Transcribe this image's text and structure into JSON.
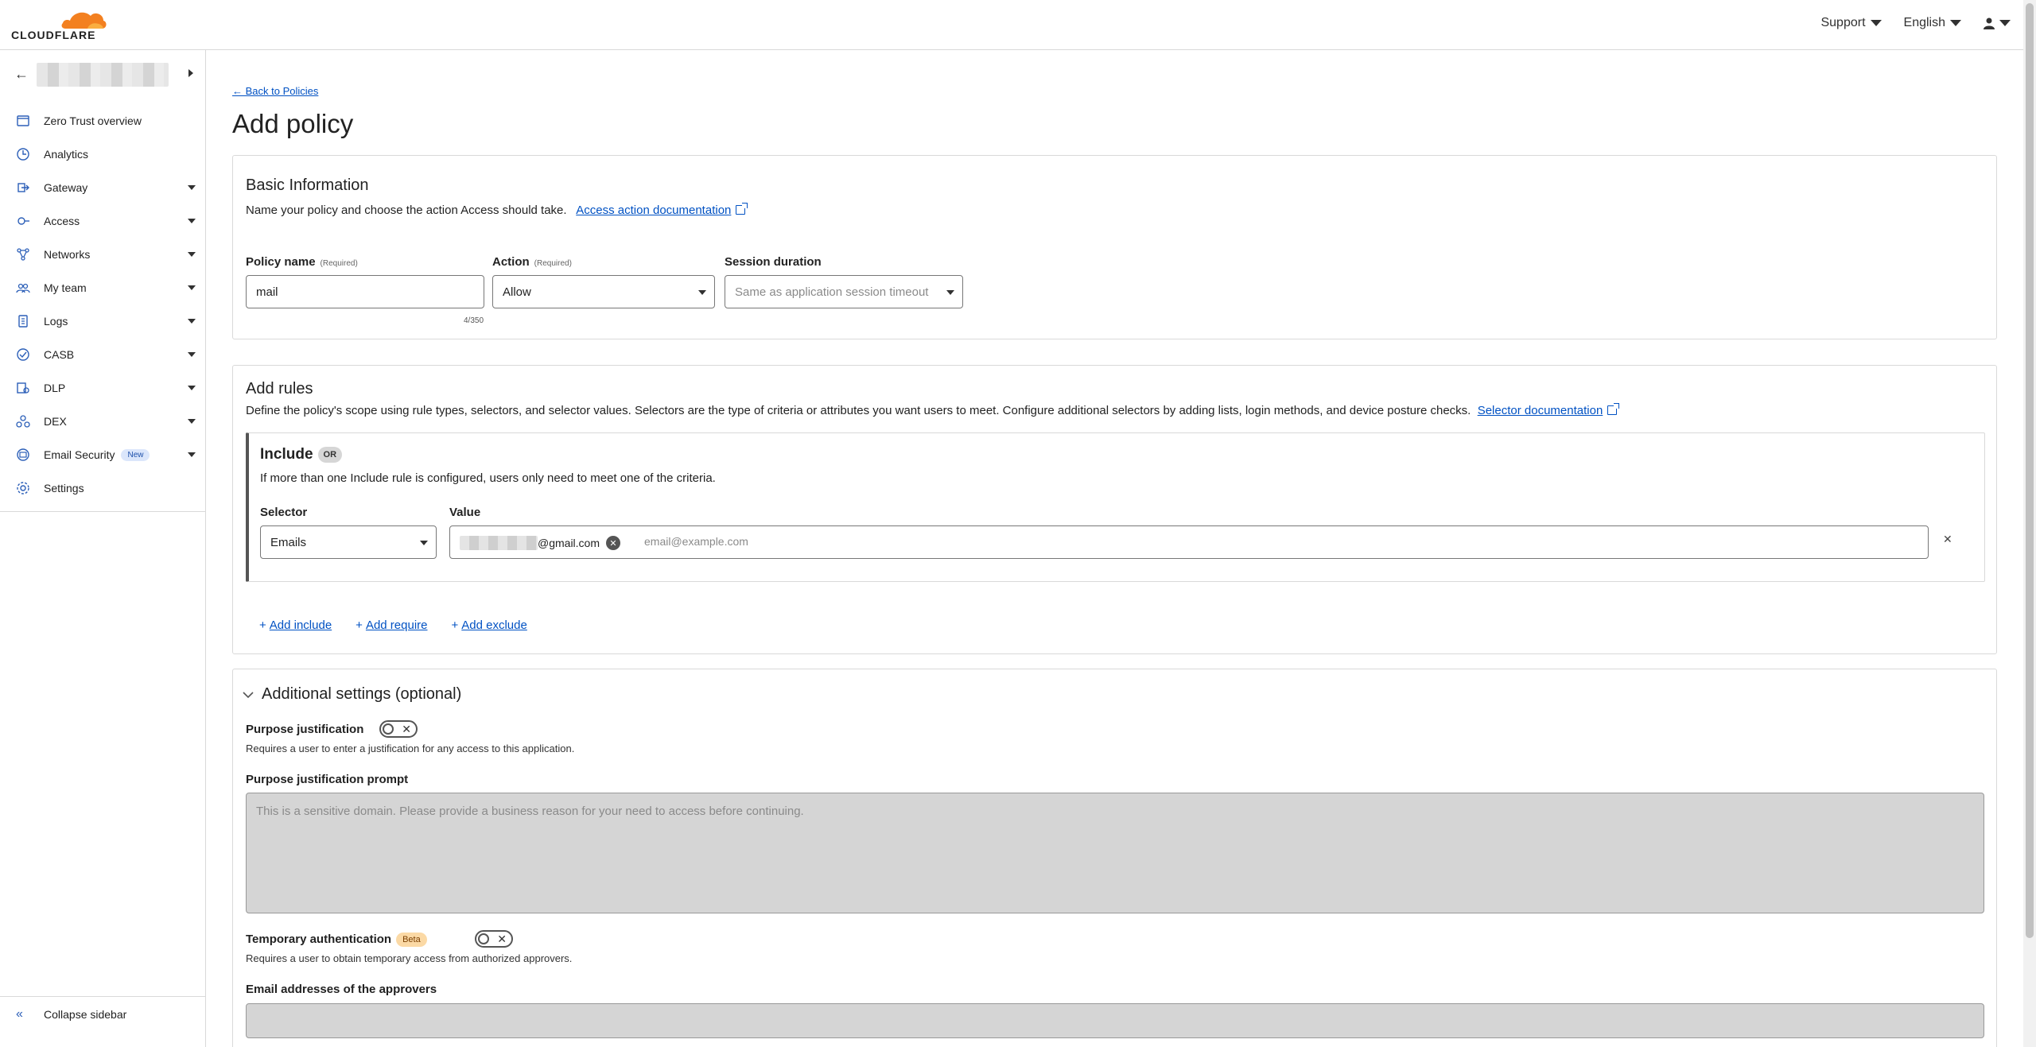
{
  "brand": {
    "name": "CLOUDFLARE",
    "accent": "#f38020"
  },
  "topbar": {
    "support": "Support",
    "language": "English"
  },
  "sidebar": {
    "items": [
      {
        "label": "Zero Trust overview",
        "icon": "overview-icon",
        "has_caret": false
      },
      {
        "label": "Analytics",
        "icon": "analytics-icon",
        "has_caret": false
      },
      {
        "label": "Gateway",
        "icon": "gateway-icon",
        "has_caret": true
      },
      {
        "label": "Access",
        "icon": "access-icon",
        "has_caret": true
      },
      {
        "label": "Networks",
        "icon": "networks-icon",
        "has_caret": true
      },
      {
        "label": "My team",
        "icon": "team-icon",
        "has_caret": true
      },
      {
        "label": "Logs",
        "icon": "logs-icon",
        "has_caret": true
      },
      {
        "label": "CASB",
        "icon": "casb-icon",
        "has_caret": true
      },
      {
        "label": "DLP",
        "icon": "dlp-icon",
        "has_caret": true
      },
      {
        "label": "DEX",
        "icon": "dex-icon",
        "has_caret": true
      },
      {
        "label": "Email Security",
        "icon": "email-security-icon",
        "has_caret": true,
        "badge": "New"
      },
      {
        "label": "Settings",
        "icon": "settings-icon",
        "has_caret": false
      }
    ],
    "collapse_label": "Collapse sidebar"
  },
  "page": {
    "back_link": "← Back to Policies",
    "title": "Add policy"
  },
  "basic": {
    "title": "Basic Information",
    "desc": "Name your policy and choose the action Access should take.",
    "doc_link": "Access action documentation",
    "policy_name_label": "Policy name",
    "required": "(Required)",
    "policy_name_value": "mail",
    "counter": "4/350",
    "action_label": "Action",
    "action_value": "Allow",
    "session_label": "Session duration",
    "session_placeholder": "Same as application session timeout"
  },
  "rules": {
    "title": "Add rules",
    "desc": "Define the policy's scope using rule types, selectors, and selector values. Selectors are the type of criteria or attributes you want users to meet. Configure additional selectors by adding lists, login methods, and device posture checks.",
    "doc_link": "Selector documentation",
    "include_title": "Include",
    "or_badge": "OR",
    "include_desc": "If more than one Include rule is configured, users only need to meet one of the criteria.",
    "selector_label": "Selector",
    "selector_value": "Emails",
    "value_label": "Value",
    "chip_suffix": "@gmail.com",
    "value_placeholder": "email@example.com",
    "add_include": "Add include",
    "add_require": "Add require",
    "add_exclude": "Add exclude"
  },
  "additional": {
    "title": "Additional settings (optional)",
    "purpose_label": "Purpose justification",
    "purpose_desc": "Requires a user to enter a justification for any access to this application.",
    "prompt_label": "Purpose justification prompt",
    "prompt_placeholder": "This is a sensitive domain. Please provide a business reason for your need to access before continuing.",
    "temp_label": "Temporary authentication",
    "beta": "Beta",
    "temp_desc": "Requires a user to obtain temporary access from authorized approvers.",
    "approvers_label": "Email addresses of the approvers"
  }
}
